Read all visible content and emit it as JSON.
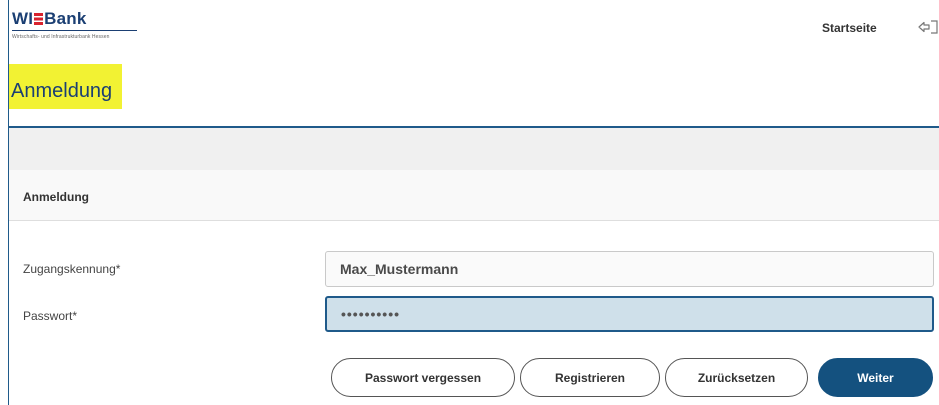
{
  "header": {
    "logo": {
      "brand_prefix": "WI",
      "brand_suffix": "Bank",
      "tagline": "Wirtschafts- und Infrastrukturbank Hessen"
    },
    "nav_home": "Startseite",
    "logout_icon": "logout-icon"
  },
  "page": {
    "title": "Anmeldung"
  },
  "section": {
    "title": "Anmeldung"
  },
  "form": {
    "username_label": "Zugangskennung*",
    "username_value": "Max_Mustermann",
    "password_label": "Passwort*",
    "password_value": "••••••••••"
  },
  "buttons": {
    "forgot": "Passwort vergessen",
    "register": "Registrieren",
    "reset": "Zurücksetzen",
    "next": "Weiter"
  },
  "colors": {
    "brand_blue": "#1b3f73",
    "accent_red": "#d9232e",
    "highlight": "#f2f233",
    "primary_button": "#14517f",
    "focused_input": "#cfe0ea"
  }
}
